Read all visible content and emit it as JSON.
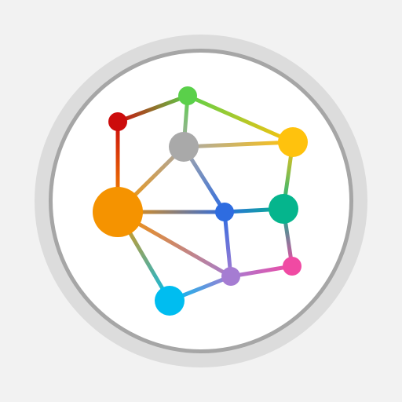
{
  "icon": {
    "name": "network-graph-app-icon",
    "background": "#f2f2f2",
    "badge": {
      "outer_ring": "#dcdcdc",
      "inner_ring": "#a6a6a6",
      "face": "#ffffff"
    },
    "nodes": [
      {
        "id": "red",
        "color": "#cc0c0c"
      },
      {
        "id": "green",
        "color": "#5ad04a"
      },
      {
        "id": "gray",
        "color": "#a9a9a9"
      },
      {
        "id": "yellow",
        "color": "#ffc20d"
      },
      {
        "id": "orange",
        "color": "#f59300"
      },
      {
        "id": "blue",
        "color": "#2e6ce0"
      },
      {
        "id": "teal",
        "color": "#05b58d"
      },
      {
        "id": "pink",
        "color": "#f04aa3"
      },
      {
        "id": "purple",
        "color": "#a57cd2"
      },
      {
        "id": "cyan",
        "color": "#00bdf0"
      }
    ],
    "edges": [
      [
        "red",
        "green"
      ],
      [
        "red",
        "orange"
      ],
      [
        "green",
        "gray"
      ],
      [
        "green",
        "yellow"
      ],
      [
        "gray",
        "yellow"
      ],
      [
        "gray",
        "orange"
      ],
      [
        "gray",
        "blue"
      ],
      [
        "orange",
        "blue"
      ],
      [
        "orange",
        "cyan"
      ],
      [
        "orange",
        "purple"
      ],
      [
        "yellow",
        "teal"
      ],
      [
        "blue",
        "teal"
      ],
      [
        "blue",
        "purple"
      ],
      [
        "teal",
        "pink"
      ],
      [
        "purple",
        "pink"
      ],
      [
        "purple",
        "cyan"
      ]
    ]
  }
}
